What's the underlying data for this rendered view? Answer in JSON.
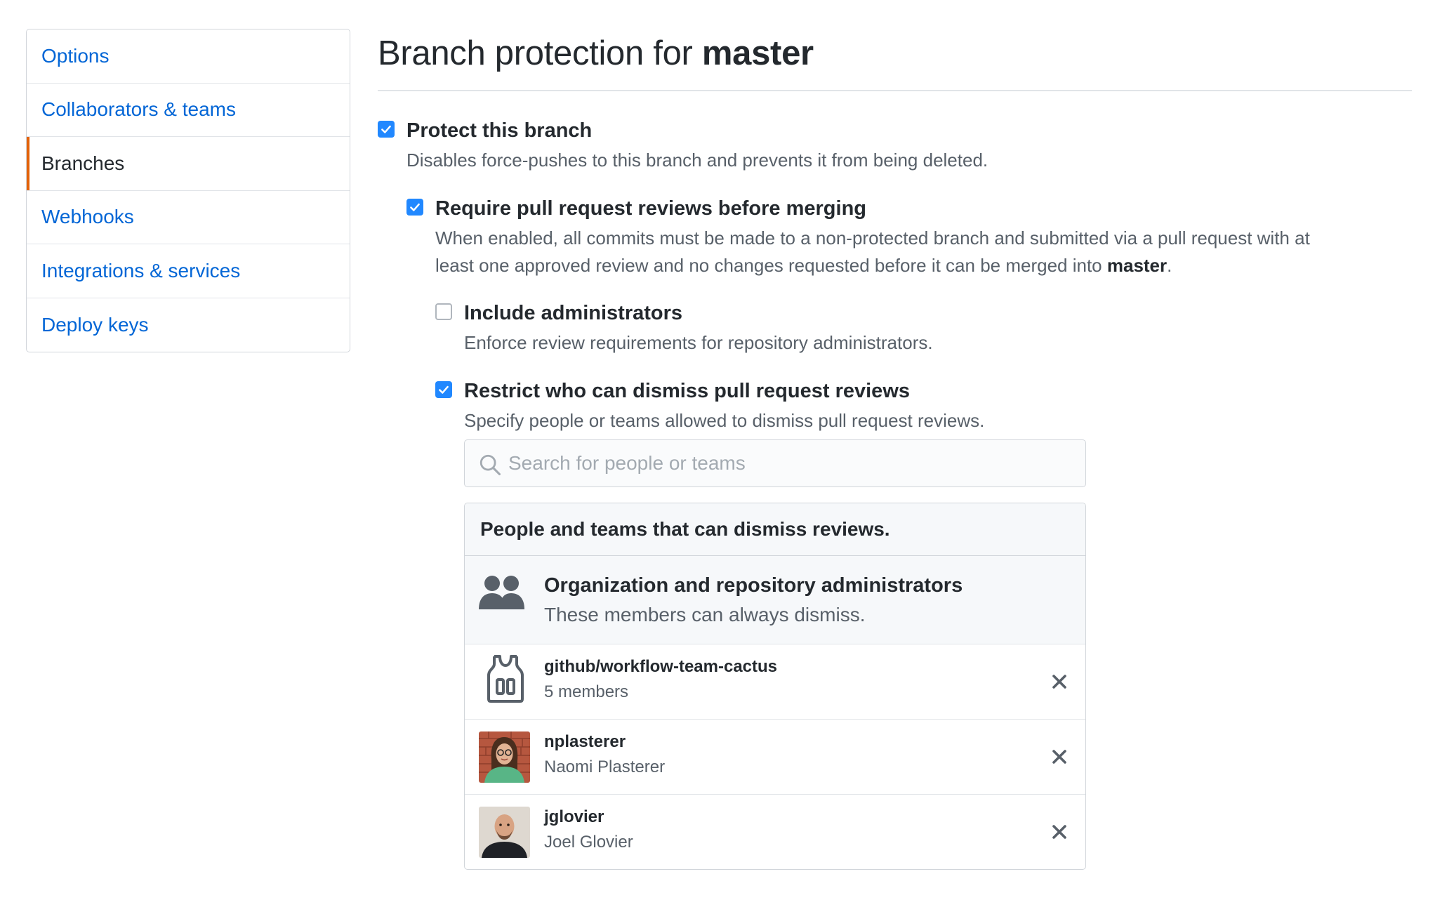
{
  "sidebar": {
    "items": [
      {
        "label": "Options"
      },
      {
        "label": "Collaborators & teams"
      },
      {
        "label": "Branches"
      },
      {
        "label": "Webhooks"
      },
      {
        "label": "Integrations & services"
      },
      {
        "label": "Deploy keys"
      }
    ],
    "active": "Branches"
  },
  "page": {
    "title_prefix": "Branch protection for ",
    "branch": "master"
  },
  "options": {
    "protect": {
      "label": "Protect this branch",
      "desc": "Disables force-pushes to this branch and prevents it from being deleted.",
      "checked": true
    },
    "require_reviews": {
      "label": "Require pull request reviews before merging",
      "desc_line1": "When enabled, all commits must be made to a non-protected branch and submitted via a pull request with at",
      "desc_line2_prefix": "least one approved review and no changes requested before it can be merged into ",
      "desc_line2_branch": "master",
      "desc_line2_suffix": ".",
      "checked": true
    },
    "include_admins": {
      "label": "Include administrators",
      "desc": "Enforce review requirements for repository administrators.",
      "checked": false
    },
    "restrict_dismiss": {
      "label": "Restrict who can dismiss pull request reviews",
      "desc": "Specify people or teams allowed to dismiss pull request reviews.",
      "checked": true
    }
  },
  "search": {
    "placeholder": "Search for people or teams",
    "value": ""
  },
  "dismiss_panel": {
    "header": "People and teams that can dismiss reviews.",
    "admins": {
      "title": "Organization and repository administrators",
      "subtitle": "These members can always dismiss."
    },
    "members": [
      {
        "name": "github/workflow-team-cactus",
        "sub": "5 members",
        "kind": "team",
        "icon": "team-jersey-icon"
      },
      {
        "name": "nplasterer",
        "sub": "Naomi Plasterer",
        "kind": "user",
        "icon": "avatar"
      },
      {
        "name": "jglovier",
        "sub": "Joel Glovier",
        "kind": "user",
        "icon": "avatar"
      }
    ]
  },
  "colors": {
    "link": "#0366d6",
    "accent_active": "#e36209",
    "checkbox": "#2188ff",
    "text": "#24292e",
    "muted": "#586069"
  }
}
